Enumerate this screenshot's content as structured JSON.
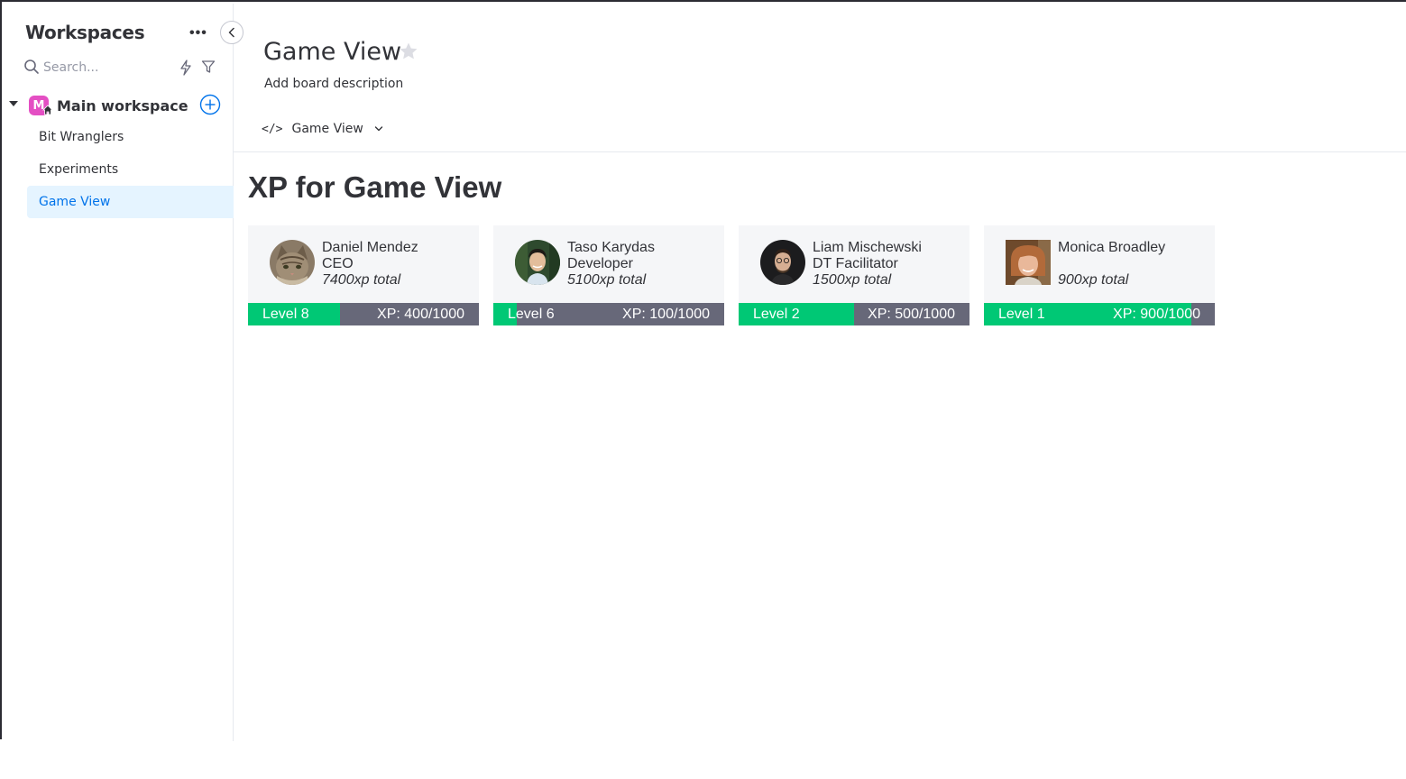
{
  "sidebar": {
    "title": "Workspaces",
    "more_label": "•••",
    "search_placeholder": "Search...",
    "workspace": {
      "initial": "M",
      "name": "Main workspace",
      "color": "#e44fc3"
    },
    "items": [
      {
        "label": "Bit Wranglers",
        "active": false
      },
      {
        "label": "Experiments",
        "active": false
      },
      {
        "label": "Game View",
        "active": true
      }
    ]
  },
  "header": {
    "title": "Game View",
    "description": "Add board description",
    "view_tab": {
      "icon": "</>",
      "label": "Game View"
    }
  },
  "xp_board": {
    "title": "XP for Game View",
    "colors": {
      "progress": "#00c875",
      "track": "#676879",
      "card_bg": "#f5f6f8"
    },
    "cards": [
      {
        "name": "Daniel Mendez",
        "role": "CEO",
        "total": "7400xp total",
        "level": "Level 8",
        "xp": "XP: 400/1000",
        "progress": 0.4,
        "avatar": "cat-photo"
      },
      {
        "name": "Taso Karydas",
        "role": "Developer",
        "total": "5100xp total",
        "level": "Level 6",
        "xp": "XP: 100/1000",
        "progress": 0.1,
        "avatar": "person-photo"
      },
      {
        "name": "Liam Mischewski",
        "role": "DT Facilitator",
        "total": "1500xp total",
        "level": "Level 2",
        "xp": "XP: 500/1000",
        "progress": 0.5,
        "avatar": "person-photo"
      },
      {
        "name": "Monica Broadley",
        "role": "",
        "total": "900xp total",
        "level": "Level 1",
        "xp": "XP: 900/1000",
        "progress": 0.9,
        "avatar": "person-photo"
      }
    ]
  }
}
